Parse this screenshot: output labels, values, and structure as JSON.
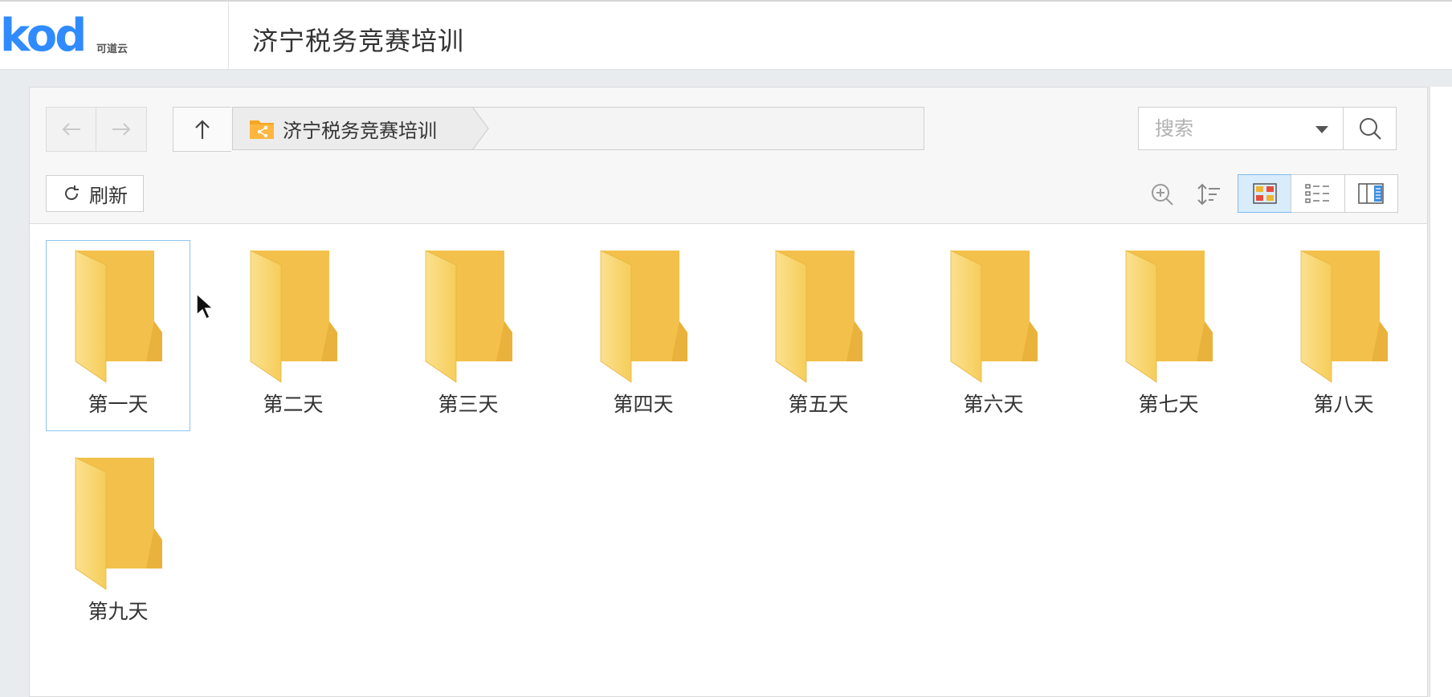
{
  "header": {
    "logo_text": "kod",
    "logo_sub": "可道云",
    "title": "济宁税务竞赛培训"
  },
  "pathbar": {
    "back_icon": "arrow-left-icon",
    "forward_icon": "arrow-right-icon",
    "up_icon": "arrow-up-icon",
    "crumb_label": "济宁税务竞赛培训",
    "search_placeholder": "搜索"
  },
  "toolbar": {
    "refresh_label": "刷新",
    "active_view": "icon-view"
  },
  "files": [
    {
      "name": "第一天",
      "selected": true
    },
    {
      "name": "第二天",
      "selected": false
    },
    {
      "name": "第三天",
      "selected": false
    },
    {
      "name": "第四天",
      "selected": false
    },
    {
      "name": "第五天",
      "selected": false
    },
    {
      "name": "第六天",
      "selected": false
    },
    {
      "name": "第七天",
      "selected": false
    },
    {
      "name": "第八天",
      "selected": false
    },
    {
      "name": "第九天",
      "selected": false
    }
  ],
  "colors": {
    "brand": "#2f8bff",
    "folder_front": "#f9d56e",
    "folder_back": "#eeb83e",
    "selection_border": "#8ec5f2"
  }
}
